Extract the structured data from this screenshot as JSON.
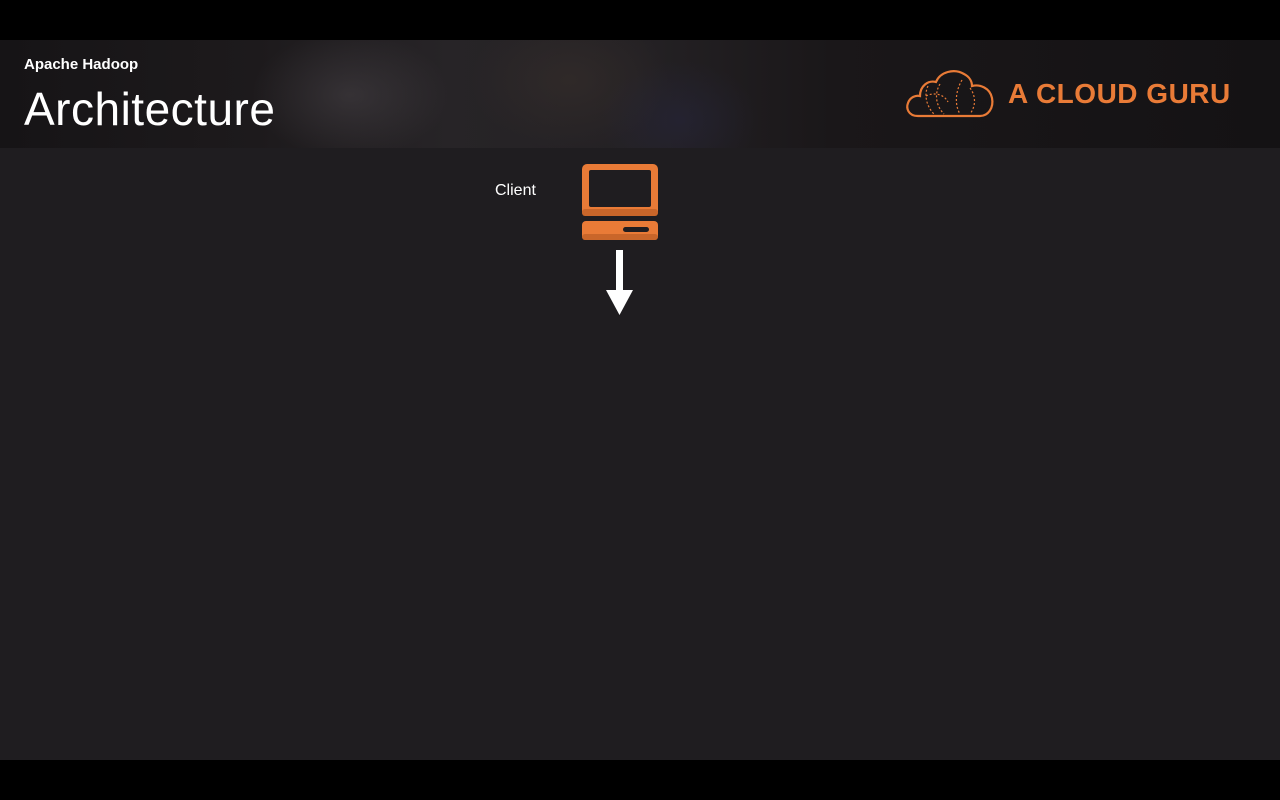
{
  "header": {
    "subtitle": "Apache Hadoop",
    "title": "Architecture"
  },
  "logo": {
    "text": "A CLOUD GURU",
    "icon": "cloud-logo-icon",
    "color": "#e97b37"
  },
  "diagram": {
    "client_label": "Client",
    "client_icon": "computer-icon",
    "arrow_icon": "arrow-down-icon",
    "accent_color": "#e97b37"
  },
  "colors": {
    "background": "#1f1d20",
    "text": "#ffffff"
  }
}
